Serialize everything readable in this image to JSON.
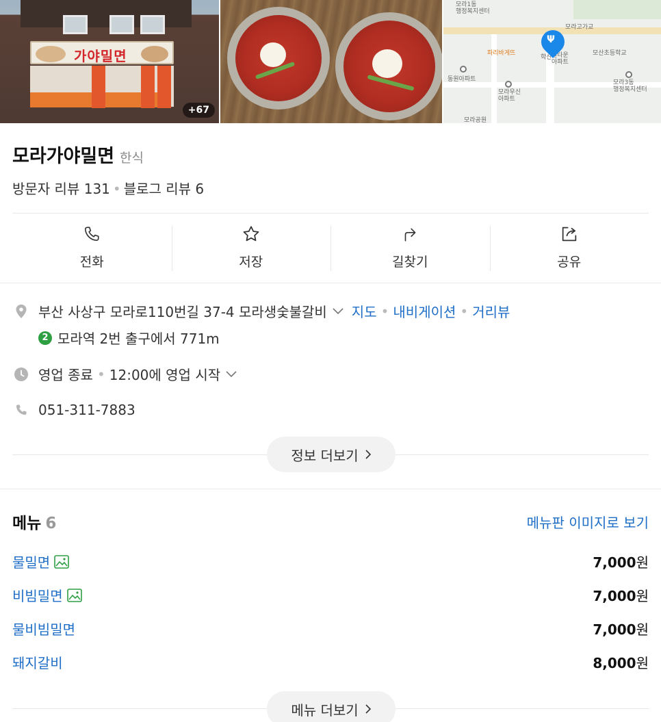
{
  "photos": {
    "more_count": "+67",
    "storefront_sign": "가야밀면",
    "map_labels": [
      "모라1동\n행정복지센터",
      "모라고가교",
      "파리바게뜨",
      "학산",
      "빌타운\n아파트",
      "모산초등학교",
      "동원아파트",
      "모라3동\n행정복지센터",
      "모라우신\n아파트",
      "모라공원"
    ]
  },
  "place": {
    "name": "모라가야밀면",
    "category": "한식",
    "visitor_reviews": "방문자 리뷰 131",
    "blog_reviews": "블로그 리뷰 6"
  },
  "actions": [
    {
      "label": "전화",
      "icon": "phone-icon"
    },
    {
      "label": "저장",
      "icon": "star-icon"
    },
    {
      "label": "길찾기",
      "icon": "directions-icon"
    },
    {
      "label": "공유",
      "icon": "share-icon"
    }
  ],
  "info": {
    "address": "부산 사상구 모라로110번길 37-4 모라생숯불갈비",
    "links": [
      "지도",
      "내비게이션",
      "거리뷰"
    ],
    "subway_line": "2",
    "subway_text": "모라역 2번 출구에서 771m",
    "status": "영업 종료",
    "status_detail": "12:00에 영업 시작",
    "phone": "051-311-7883",
    "more_info": "정보 더보기"
  },
  "menu": {
    "title": "메뉴",
    "count": "6",
    "board_link": "메뉴판 이미지로 보기",
    "items": [
      {
        "name": "물밀면",
        "price": "7,000",
        "unit": "원",
        "has_image": true
      },
      {
        "name": "비빔밀면",
        "price": "7,000",
        "unit": "원",
        "has_image": true
      },
      {
        "name": "물비빔밀면",
        "price": "7,000",
        "unit": "원",
        "has_image": false
      },
      {
        "name": "돼지갈비",
        "price": "8,000",
        "unit": "원",
        "has_image": false
      }
    ],
    "more_menu": "메뉴 더보기"
  },
  "colors": {
    "link": "#1e6ec8",
    "subway_line2": "#2ea043",
    "map_pin": "#1a88e8"
  }
}
